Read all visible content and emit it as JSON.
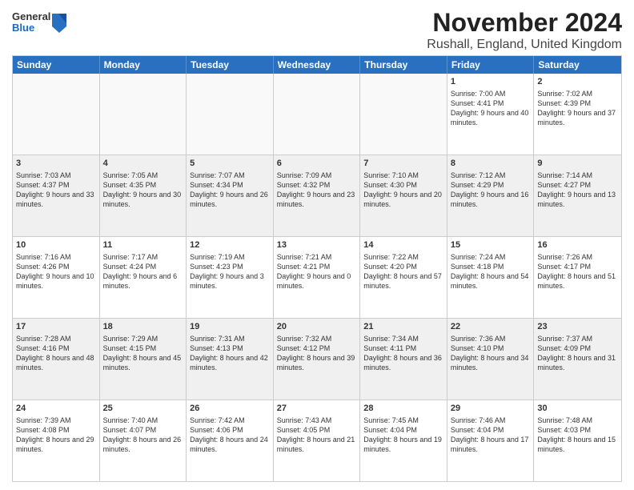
{
  "logo": {
    "general": "General",
    "blue": "Blue"
  },
  "title": "November 2024",
  "subtitle": "Rushall, England, United Kingdom",
  "header_days": [
    "Sunday",
    "Monday",
    "Tuesday",
    "Wednesday",
    "Thursday",
    "Friday",
    "Saturday"
  ],
  "rows": [
    [
      {
        "day": "",
        "info": "",
        "empty": true
      },
      {
        "day": "",
        "info": "",
        "empty": true
      },
      {
        "day": "",
        "info": "",
        "empty": true
      },
      {
        "day": "",
        "info": "",
        "empty": true
      },
      {
        "day": "",
        "info": "",
        "empty": true
      },
      {
        "day": "1",
        "info": "Sunrise: 7:00 AM\nSunset: 4:41 PM\nDaylight: 9 hours and 40 minutes.",
        "empty": false
      },
      {
        "day": "2",
        "info": "Sunrise: 7:02 AM\nSunset: 4:39 PM\nDaylight: 9 hours and 37 minutes.",
        "empty": false
      }
    ],
    [
      {
        "day": "3",
        "info": "Sunrise: 7:03 AM\nSunset: 4:37 PM\nDaylight: 9 hours and 33 minutes.",
        "empty": false
      },
      {
        "day": "4",
        "info": "Sunrise: 7:05 AM\nSunset: 4:35 PM\nDaylight: 9 hours and 30 minutes.",
        "empty": false
      },
      {
        "day": "5",
        "info": "Sunrise: 7:07 AM\nSunset: 4:34 PM\nDaylight: 9 hours and 26 minutes.",
        "empty": false
      },
      {
        "day": "6",
        "info": "Sunrise: 7:09 AM\nSunset: 4:32 PM\nDaylight: 9 hours and 23 minutes.",
        "empty": false
      },
      {
        "day": "7",
        "info": "Sunrise: 7:10 AM\nSunset: 4:30 PM\nDaylight: 9 hours and 20 minutes.",
        "empty": false
      },
      {
        "day": "8",
        "info": "Sunrise: 7:12 AM\nSunset: 4:29 PM\nDaylight: 9 hours and 16 minutes.",
        "empty": false
      },
      {
        "day": "9",
        "info": "Sunrise: 7:14 AM\nSunset: 4:27 PM\nDaylight: 9 hours and 13 minutes.",
        "empty": false
      }
    ],
    [
      {
        "day": "10",
        "info": "Sunrise: 7:16 AM\nSunset: 4:26 PM\nDaylight: 9 hours and 10 minutes.",
        "empty": false
      },
      {
        "day": "11",
        "info": "Sunrise: 7:17 AM\nSunset: 4:24 PM\nDaylight: 9 hours and 6 minutes.",
        "empty": false
      },
      {
        "day": "12",
        "info": "Sunrise: 7:19 AM\nSunset: 4:23 PM\nDaylight: 9 hours and 3 minutes.",
        "empty": false
      },
      {
        "day": "13",
        "info": "Sunrise: 7:21 AM\nSunset: 4:21 PM\nDaylight: 9 hours and 0 minutes.",
        "empty": false
      },
      {
        "day": "14",
        "info": "Sunrise: 7:22 AM\nSunset: 4:20 PM\nDaylight: 8 hours and 57 minutes.",
        "empty": false
      },
      {
        "day": "15",
        "info": "Sunrise: 7:24 AM\nSunset: 4:18 PM\nDaylight: 8 hours and 54 minutes.",
        "empty": false
      },
      {
        "day": "16",
        "info": "Sunrise: 7:26 AM\nSunset: 4:17 PM\nDaylight: 8 hours and 51 minutes.",
        "empty": false
      }
    ],
    [
      {
        "day": "17",
        "info": "Sunrise: 7:28 AM\nSunset: 4:16 PM\nDaylight: 8 hours and 48 minutes.",
        "empty": false
      },
      {
        "day": "18",
        "info": "Sunrise: 7:29 AM\nSunset: 4:15 PM\nDaylight: 8 hours and 45 minutes.",
        "empty": false
      },
      {
        "day": "19",
        "info": "Sunrise: 7:31 AM\nSunset: 4:13 PM\nDaylight: 8 hours and 42 minutes.",
        "empty": false
      },
      {
        "day": "20",
        "info": "Sunrise: 7:32 AM\nSunset: 4:12 PM\nDaylight: 8 hours and 39 minutes.",
        "empty": false
      },
      {
        "day": "21",
        "info": "Sunrise: 7:34 AM\nSunset: 4:11 PM\nDaylight: 8 hours and 36 minutes.",
        "empty": false
      },
      {
        "day": "22",
        "info": "Sunrise: 7:36 AM\nSunset: 4:10 PM\nDaylight: 8 hours and 34 minutes.",
        "empty": false
      },
      {
        "day": "23",
        "info": "Sunrise: 7:37 AM\nSunset: 4:09 PM\nDaylight: 8 hours and 31 minutes.",
        "empty": false
      }
    ],
    [
      {
        "day": "24",
        "info": "Sunrise: 7:39 AM\nSunset: 4:08 PM\nDaylight: 8 hours and 29 minutes.",
        "empty": false
      },
      {
        "day": "25",
        "info": "Sunrise: 7:40 AM\nSunset: 4:07 PM\nDaylight: 8 hours and 26 minutes.",
        "empty": false
      },
      {
        "day": "26",
        "info": "Sunrise: 7:42 AM\nSunset: 4:06 PM\nDaylight: 8 hours and 24 minutes.",
        "empty": false
      },
      {
        "day": "27",
        "info": "Sunrise: 7:43 AM\nSunset: 4:05 PM\nDaylight: 8 hours and 21 minutes.",
        "empty": false
      },
      {
        "day": "28",
        "info": "Sunrise: 7:45 AM\nSunset: 4:04 PM\nDaylight: 8 hours and 19 minutes.",
        "empty": false
      },
      {
        "day": "29",
        "info": "Sunrise: 7:46 AM\nSunset: 4:04 PM\nDaylight: 8 hours and 17 minutes.",
        "empty": false
      },
      {
        "day": "30",
        "info": "Sunrise: 7:48 AM\nSunset: 4:03 PM\nDaylight: 8 hours and 15 minutes.",
        "empty": false
      }
    ]
  ]
}
